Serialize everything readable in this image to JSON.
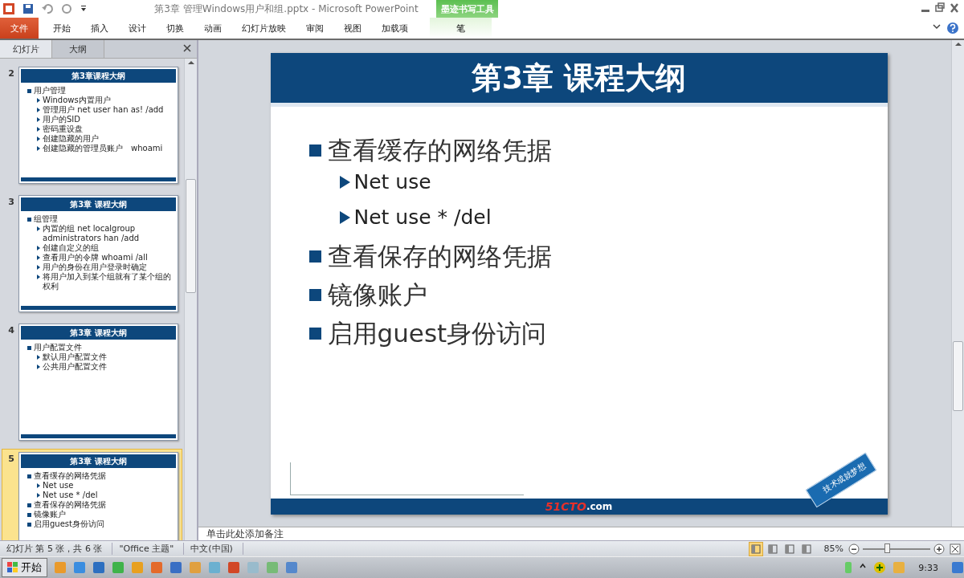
{
  "window": {
    "title": "第3章 管理Windows用户和组.pptx - Microsoft PowerPoint"
  },
  "ribbon": {
    "tabs": [
      {
        "label": "文件",
        "kind": "file",
        "selected": false
      },
      {
        "label": "开始",
        "kind": "tab",
        "selected": false
      },
      {
        "label": "插入",
        "kind": "tab",
        "selected": false
      },
      {
        "label": "设计",
        "kind": "tab",
        "selected": false
      },
      {
        "label": "切换",
        "kind": "tab",
        "selected": false
      },
      {
        "label": "动画",
        "kind": "tab",
        "selected": false
      },
      {
        "label": "幻灯片放映",
        "kind": "tab",
        "selected": false
      },
      {
        "label": "审阅",
        "kind": "tab",
        "selected": false
      },
      {
        "label": "视图",
        "kind": "tab",
        "selected": false
      },
      {
        "label": "加载项",
        "kind": "tab",
        "selected": false
      }
    ],
    "contextual": {
      "group": "墨迹书写工具",
      "tab": "笔"
    }
  },
  "pane": {
    "tabs": [
      {
        "label": "幻灯片",
        "selected": true
      },
      {
        "label": "大纲",
        "selected": false
      }
    ]
  },
  "thumbnails": [
    {
      "number": "2",
      "selected": false,
      "title": "第3章课程大纲",
      "bullets": [
        {
          "text": "用户管理",
          "children": [
            {
              "text": "Windows内置用户"
            },
            {
              "text": "管理用户 net user han as! /add"
            },
            {
              "text": "用户的SID"
            },
            {
              "text": "密码重设盘"
            },
            {
              "text": "创建隐藏的用户"
            },
            {
              "text": "创建隐藏的管理员账户　whoami"
            }
          ]
        }
      ]
    },
    {
      "number": "3",
      "selected": false,
      "title": "第3章 课程大纲",
      "bullets": [
        {
          "text": "组管理",
          "children": [
            {
              "text": "内置的组 net localgroup administrators han /add"
            },
            {
              "text": "创建自定义的组"
            },
            {
              "text": "查看用户的令牌 whoami /all"
            },
            {
              "text": "用户的身份在用户登录时确定"
            },
            {
              "text": "将用户加入到某个组就有了某个组的权利"
            }
          ]
        }
      ]
    },
    {
      "number": "4",
      "selected": false,
      "title": "第3章 课程大纲",
      "bullets": [
        {
          "text": "用户配置文件",
          "children": [
            {
              "text": "默认用户配置文件"
            },
            {
              "text": "公共用户配置文件"
            }
          ]
        }
      ]
    },
    {
      "number": "5",
      "selected": true,
      "title": "第3章 课程大纲",
      "bullets": [
        {
          "text": "查看缓存的网络凭据",
          "children": [
            {
              "text": "Net use"
            },
            {
              "text": "Net use * /del"
            }
          ]
        },
        {
          "text": "查看保存的网络凭据"
        },
        {
          "text": "镜像账户"
        },
        {
          "text": "启用guest身份访问"
        }
      ]
    }
  ],
  "slide": {
    "title": "第3章 课程大纲",
    "bullets": [
      {
        "text": "查看缓存的网络凭据",
        "children": [
          {
            "text": "Net use"
          },
          {
            "text": "Net use * /del"
          }
        ]
      },
      {
        "text": "查看保存的网络凭据"
      },
      {
        "text": "镜像账户"
      },
      {
        "text": "启用guest身份访问"
      }
    ],
    "logo": {
      "main": "51CTO",
      "suffix": ".com"
    },
    "badge": "技术成就梦想"
  },
  "notes": {
    "placeholder": "单击此处添加备注"
  },
  "status_bar": {
    "items": [
      "幻灯片 第 5 张，共 6 张",
      "\"Office 主题\"",
      "中文(中国)"
    ],
    "views": [
      {
        "selected": true
      },
      {
        "selected": false
      },
      {
        "selected": false
      },
      {
        "selected": false
      }
    ],
    "zoom": "85%",
    "level": 0.37
  },
  "taskbar": {
    "start": "开始",
    "time": "9:33"
  }
}
